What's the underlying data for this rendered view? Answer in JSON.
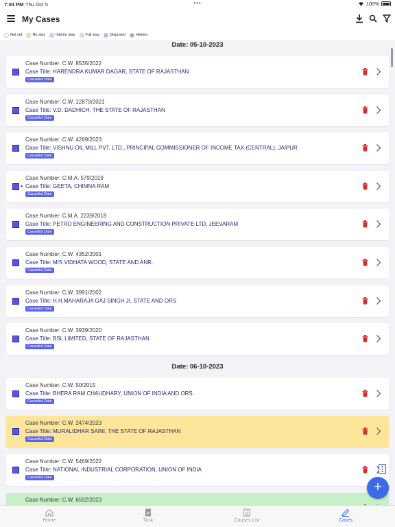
{
  "status_bar": {
    "time": "7:04 PM",
    "date": "Thu Oct 5",
    "battery": "100%"
  },
  "header": {
    "title": "My Cases"
  },
  "legend": [
    {
      "label": "Not set",
      "color": "#ffffff"
    },
    {
      "label": "No stay",
      "color": "#fde59a"
    },
    {
      "label": "Interim stay",
      "color": "#f5c6c6"
    },
    {
      "label": "Full stay",
      "color": "#c8f0c8"
    },
    {
      "label": "Disposed",
      "color": "#8fc8f0"
    },
    {
      "label": "Hidden",
      "color": "#aaaaaa"
    }
  ],
  "badge_label": "Causelist Date",
  "groups": [
    {
      "date": "Date: 05-10-2023",
      "cases": [
        {
          "number": "Case Number: C.W. 8535/2022",
          "title": "Case Title: HARENDRA KUMAR DAGAR, STATE OF RAJASTHAN",
          "status": "Not set",
          "flag": false
        },
        {
          "number": "Case Number: C.W. 12879/2021",
          "title": "Case Title: V.D. DADHICH, THE STATE OF RAJASTHAN",
          "status": "Not set",
          "flag": false
        },
        {
          "number": "Case Number: C.W. 4269/2023",
          "title": "Case Title: VISHNU OIL MILL PVT. LTD., PRINCIPAL COMMISSIONER OF INCOME TAX (CENTRAL), JAIPUR",
          "status": "Not set",
          "flag": false
        },
        {
          "number": "Case Number: C.M.A. 579/2019",
          "title": "Case Title: GEETA, CHIMNA RAM",
          "status": "Not set",
          "flag": true
        },
        {
          "number": "Case Number: C.M.A. 2239/2018",
          "title": "Case Title: PETRO ENGINEERING AND CONSTRUCTION PRIVATE LTD, JEEVARAM",
          "status": "Not set",
          "flag": false
        },
        {
          "number": "Case Number: C.W. 4352/2001",
          "title": "Case Title: M/S VIDHATA WOOD, STATE AND ANR.",
          "status": "Not set",
          "flag": false
        },
        {
          "number": "Case Number: C.W. 3991/2002",
          "title": "Case Title: H.H.MAHARAJA GAJ SINGH JI, STATE AND ORS",
          "status": "Not set",
          "flag": false
        },
        {
          "number": "Case Number: C.W. 3939/2020",
          "title": "Case Title: BSL LIMITED, STATE OF RAJASTHAN",
          "status": "Not set",
          "flag": false
        }
      ]
    },
    {
      "date": "Date: 06-10-2023",
      "cases": [
        {
          "number": "Case Number: C.W. 50/2015",
          "title": "Case Title:  BHERA RAM CHAUDHARY,  UNION OF INDIA AND ORS.",
          "status": "Not set",
          "flag": false
        },
        {
          "number": "Case Number: C.W. 2474/2023",
          "title": "Case Title: MURALIDHAR SAINI, THE STATE OF RAJASTHAN",
          "status": "No stay",
          "flag": false
        },
        {
          "number": "Case Number: C.W. 5469/2022",
          "title": "Case Title: NATIONAL INDUSTRIAL CORPORATION, UNION OF INDIA",
          "status": "Not set",
          "flag": false
        },
        {
          "number": "Case Number: C.W. 6502/2023",
          "title": "",
          "status": "Full stay",
          "flag": false
        }
      ]
    }
  ],
  "tabs": [
    {
      "label": "Home",
      "icon": "home-icon",
      "active": false
    },
    {
      "label": "Task",
      "icon": "task-icon",
      "active": false
    },
    {
      "label": "Causes List",
      "icon": "list-icon",
      "active": false
    },
    {
      "label": "Cases",
      "icon": "edit-icon",
      "active": true
    }
  ]
}
